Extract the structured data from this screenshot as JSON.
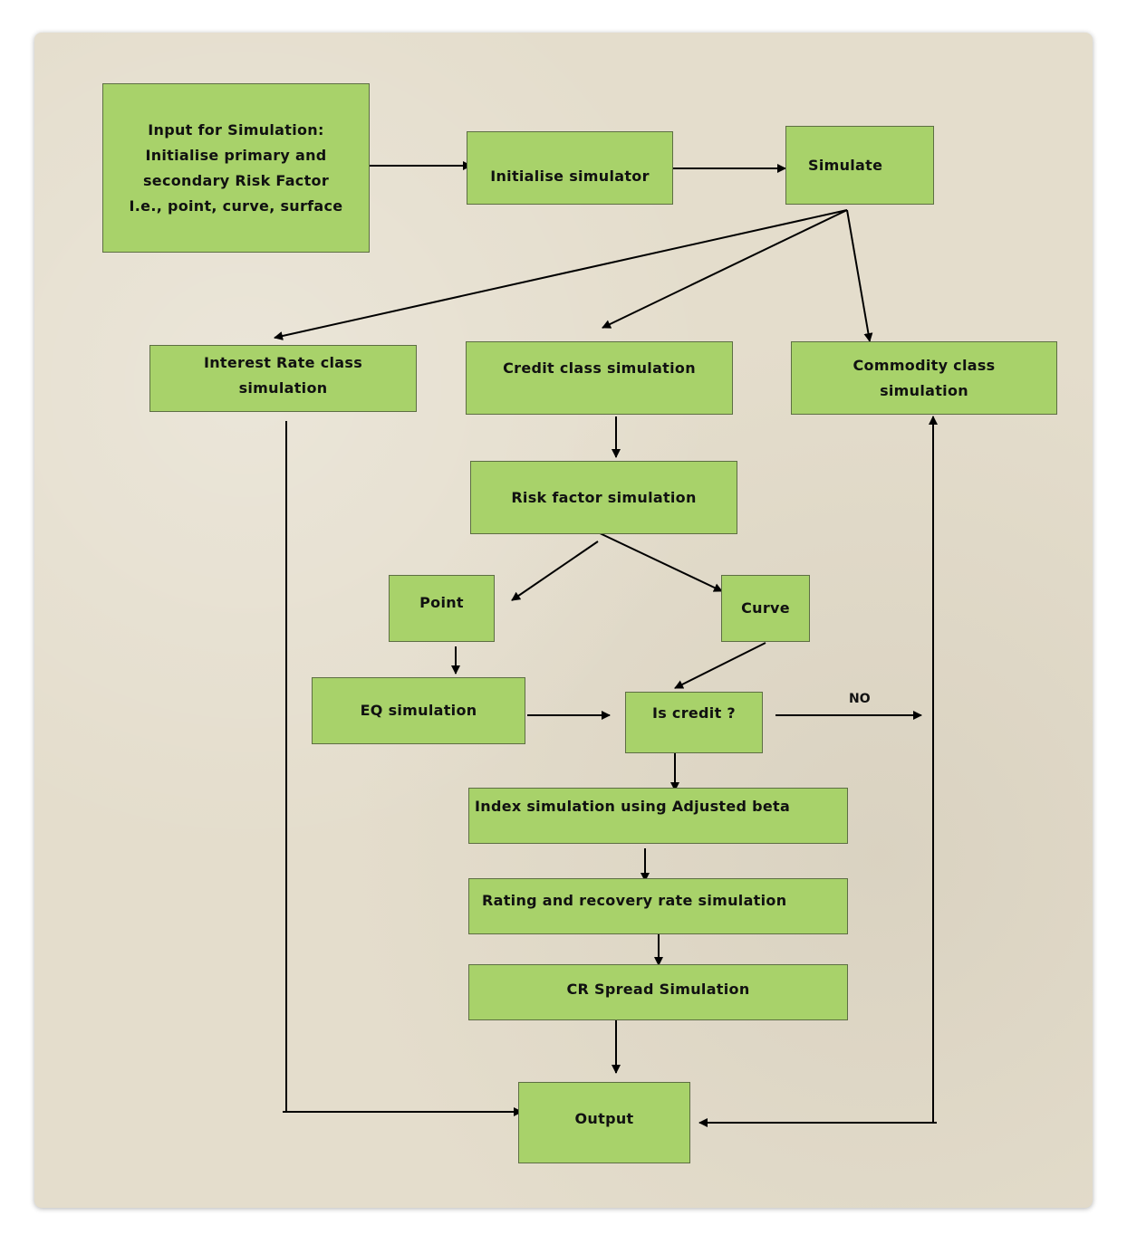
{
  "nodes": {
    "input": "Input for Simulation: Initialise primary and secondary Risk Factor I.e., point, curve, surface",
    "init": "Initialise simulator",
    "simulate": "Simulate",
    "interest_rate": "Interest Rate class simulation",
    "credit": "Credit class simulation",
    "commodity": "Commodity class simulation",
    "risk_factor": "Risk factor simulation",
    "point": "Point",
    "curve": "Curve",
    "eq": "EQ simulation",
    "is_credit": "Is credit ?",
    "index": "Index simulation using Adjusted beta",
    "rating": "Rating and recovery rate simulation",
    "cr_spread": "CR Spread Simulation",
    "output": "Output"
  },
  "edge_labels": {
    "no": "NO"
  },
  "colors": {
    "box_fill": "#a8d26a",
    "box_border": "#5d6e43",
    "paper": "#e4ddcc",
    "line": "#000000"
  }
}
